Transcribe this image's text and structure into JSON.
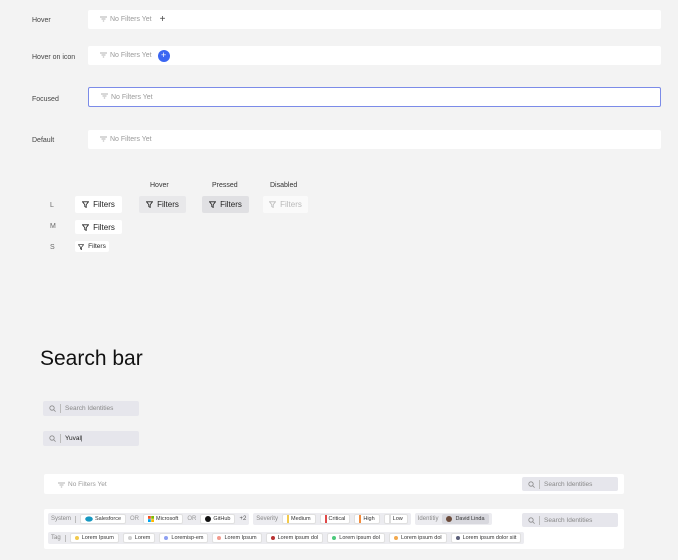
{
  "states": [
    {
      "label": "Hover",
      "placeholder": "No Filters Yet"
    },
    {
      "label": "Hover on icon",
      "placeholder": "No Filters Yet"
    },
    {
      "label": "Focused",
      "placeholder": "No Filters Yet"
    },
    {
      "label": "Default",
      "placeholder": "No Filters Yet"
    }
  ],
  "add_icon": "+",
  "button_columns": [
    "Hover",
    "Pressed",
    "Disabled"
  ],
  "sizes": [
    "L",
    "M",
    "S"
  ],
  "button_label": "Filters",
  "search_title": "Search bar",
  "search1_placeholder": "Search Identities",
  "search2_value": "Yuval|",
  "bottom_bar": {
    "placeholder": "No Filters Yet",
    "search_placeholder": "Search Identities"
  },
  "filter_bar": {
    "system_label": "System",
    "systems": [
      "Salesforce",
      "Microsoft",
      "GitHub"
    ],
    "or_label": "OR",
    "more": "+2",
    "severity_label": "Severity",
    "severities": [
      {
        "label": "Medium",
        "color": "#f2c94c"
      },
      {
        "label": "Critical",
        "color": "#e04848"
      },
      {
        "label": "High",
        "color": "#f28b3c"
      },
      {
        "label": "Low",
        "color": "#ececec"
      }
    ],
    "identity_label": "Identitiy",
    "identity_value": "David Linda",
    "tag_label": "Tag",
    "tags": [
      {
        "label": "Lorem Ipsum",
        "color": "#f2c94c"
      },
      {
        "label": "Lorem",
        "color": "#cfcfcf"
      },
      {
        "label": "Loremisp-em",
        "color": "#8ea0f2"
      },
      {
        "label": "Lorem Ipsum",
        "color": "#f29a8e"
      },
      {
        "label": "Lorem ipsum dol",
        "color": "#b83232"
      },
      {
        "label": "Lorem ipsum dol",
        "color": "#4cc97b"
      },
      {
        "label": "Lorem ipsum dol",
        "color": "#f2a84c"
      },
      {
        "label": "Lorem ipsum dolor siit",
        "color": "#5b5f7a"
      }
    ],
    "search_placeholder": "Search Identities"
  }
}
